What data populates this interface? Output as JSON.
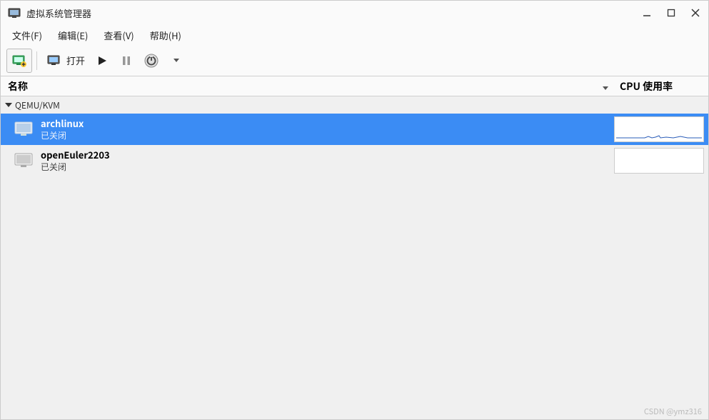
{
  "window": {
    "title": "虚拟系统管理器"
  },
  "menu": {
    "file": "文件(F)",
    "edit": "编辑(E)",
    "view": "查看(V)",
    "help": "帮助(H)"
  },
  "toolbar": {
    "open_label": "打开"
  },
  "columns": {
    "name": "名称",
    "cpu": "CPU 使用率"
  },
  "connection": {
    "label": "QEMU/KVM"
  },
  "vms": [
    {
      "name": "archlinux",
      "status": "已关闭",
      "selected": true
    },
    {
      "name": "openEuler2203",
      "status": "已关闭",
      "selected": false
    }
  ],
  "watermark": "CSDN @ymz316"
}
